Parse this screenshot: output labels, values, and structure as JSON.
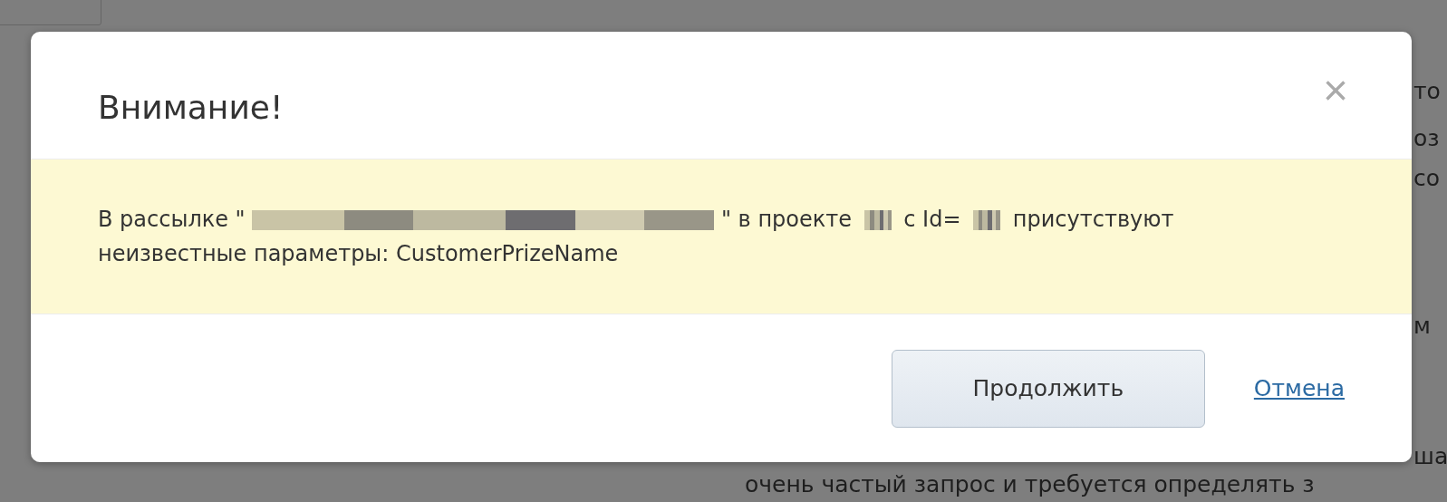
{
  "background": {
    "right_fragments": [
      "то",
      "оз",
      "со",
      "м",
      "ша"
    ],
    "bottom_line": "очень частый запрос и требуется определять з"
  },
  "dialog": {
    "title": "Внимание!",
    "close": "×",
    "message": [
      {
        "kind": "text",
        "text": "В рассылке \""
      },
      {
        "kind": "redacted_long"
      },
      {
        "kind": "text",
        "text": "\" в проекте"
      },
      {
        "kind": "redacted_short"
      },
      {
        "kind": "text",
        "text": "с Id="
      },
      {
        "kind": "redacted_short"
      },
      {
        "kind": "text",
        "text": "присутствуют"
      },
      {
        "kind": "text",
        "text": "неизвестные параметры: CustomerPrizeName"
      }
    ],
    "buttons": [
      {
        "kind": "primary",
        "label": "Продолжить"
      },
      {
        "kind": "link",
        "label": "Отмена"
      }
    ]
  }
}
